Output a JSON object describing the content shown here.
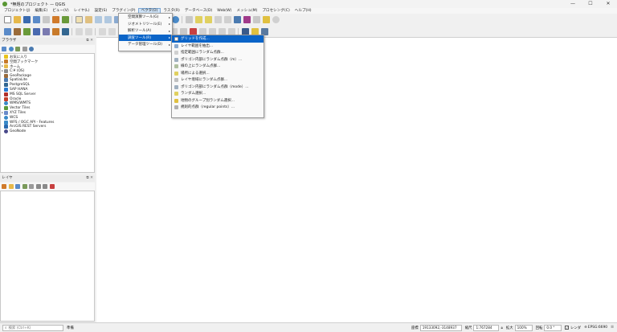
{
  "window": {
    "title": "*無題のプロジェクト — QGIS",
    "min": "—",
    "max": "☐",
    "close": "✕"
  },
  "menubar": {
    "items": [
      "プロジェクト(J)",
      "編集(E)",
      "ビュー(V)",
      "レイヤ(L)",
      "設定(S)",
      "プラグイン(P)",
      "ベクタ(O)",
      "ラスタ(R)",
      "データベース(D)",
      "Web(W)",
      "メッシュ(M)",
      "プロセシング(C)",
      "ヘルプ(H)"
    ],
    "active": "ベクタ(O)"
  },
  "vector_menu": {
    "items": [
      {
        "label": "空間演算ツール(G)"
      },
      {
        "label": "ジオメトリツール(E)"
      },
      {
        "label": "解析ツール(A)"
      },
      {
        "label": "調査ツール(R)"
      },
      {
        "label": "データ管理ツール(D)"
      }
    ],
    "highlighted": "調査ツール(R)"
  },
  "research_submenu": {
    "items": [
      {
        "label": "グリッドを作成..."
      },
      {
        "label": "レイヤ範囲を抽出..."
      },
      {
        "label": "指定範囲にランダム点群..."
      },
      {
        "label": "ポリゴン内部にランダム点群（m）..."
      },
      {
        "label": "線の上にランダム点群..."
      },
      {
        "label": "場所による選択..."
      },
      {
        "label": "レイヤ境域にランダム点群..."
      },
      {
        "label": "ポリゴン内部にランダム点群（mode）..."
      },
      {
        "label": "ランダム選択..."
      },
      {
        "label": "地物のグループ別ランダム選択..."
      },
      {
        "label": "規則的点群（regular points）..."
      }
    ],
    "highlighted": "グリッドを作成..."
  },
  "browser_panel": {
    "title": "ブラウザ",
    "items": [
      {
        "label": "お気に入り",
        "icon": "star-icon",
        "color": "#e8c21c"
      },
      {
        "label": "空間ブックマーク",
        "icon": "bookmark-icon",
        "color": "#c77a2a"
      },
      {
        "label": "ホーム",
        "icon": "folder-icon",
        "color": "#e6b84a"
      },
      {
        "label": "C:¥ (OS)",
        "icon": "drive-icon",
        "color": "#8a8a8a"
      },
      {
        "label": "GeoPackage",
        "icon": "geopackage-icon",
        "color": "#9a6b3a"
      },
      {
        "label": "SpatiaLite",
        "icon": "spatialite-icon",
        "color": "#4a7ab0"
      },
      {
        "label": "PostgreSQL",
        "icon": "postgresql-icon",
        "color": "#336791"
      },
      {
        "label": "SAP HANA",
        "icon": "saphana-icon",
        "color": "#2a7bd0"
      },
      {
        "label": "MS SQL Server",
        "icon": "mssql-icon",
        "color": "#b0302a"
      },
      {
        "label": "Oracle",
        "icon": "oracle-icon",
        "color": "#c4402a"
      },
      {
        "label": "WMS/WMTS",
        "icon": "globe-icon",
        "color": "#3a8ac8"
      },
      {
        "label": "Vector Tiles",
        "icon": "vector-tiles-icon",
        "color": "#5a9a3a"
      },
      {
        "label": "XYZ Tiles",
        "icon": "xyz-tiles-icon",
        "color": "#6a8ac8"
      },
      {
        "label": "WCS",
        "icon": "globe-icon",
        "color": "#3a8ac8"
      },
      {
        "label": "WFS / OGC API - Features",
        "icon": "wfs-icon",
        "color": "#3a8ac8"
      },
      {
        "label": "ArcGIS REST Servers",
        "icon": "arcgis-icon",
        "color": "#2a6ab0"
      },
      {
        "label": "GeoNode",
        "icon": "geonode-icon",
        "color": "#4a4a8a"
      }
    ]
  },
  "layers_panel": {
    "title": "レイヤ"
  },
  "statusbar": {
    "search_placeholder": "検索 (Ctrl+K)",
    "ready": "準備",
    "coord_label": "座標",
    "coord_value": "19133092,-3148937",
    "scale_label": "縮尺",
    "scale_value": "1:767284",
    "magnifier_label": "拡大",
    "magnifier_value": "100%",
    "rotation_label": "回転",
    "rotation_value": "0.0 °",
    "render_label": "レンダ",
    "crs": "EPSG:6690"
  },
  "colors": {
    "highlight": "#0a64c8",
    "accent_green": "#589632"
  }
}
